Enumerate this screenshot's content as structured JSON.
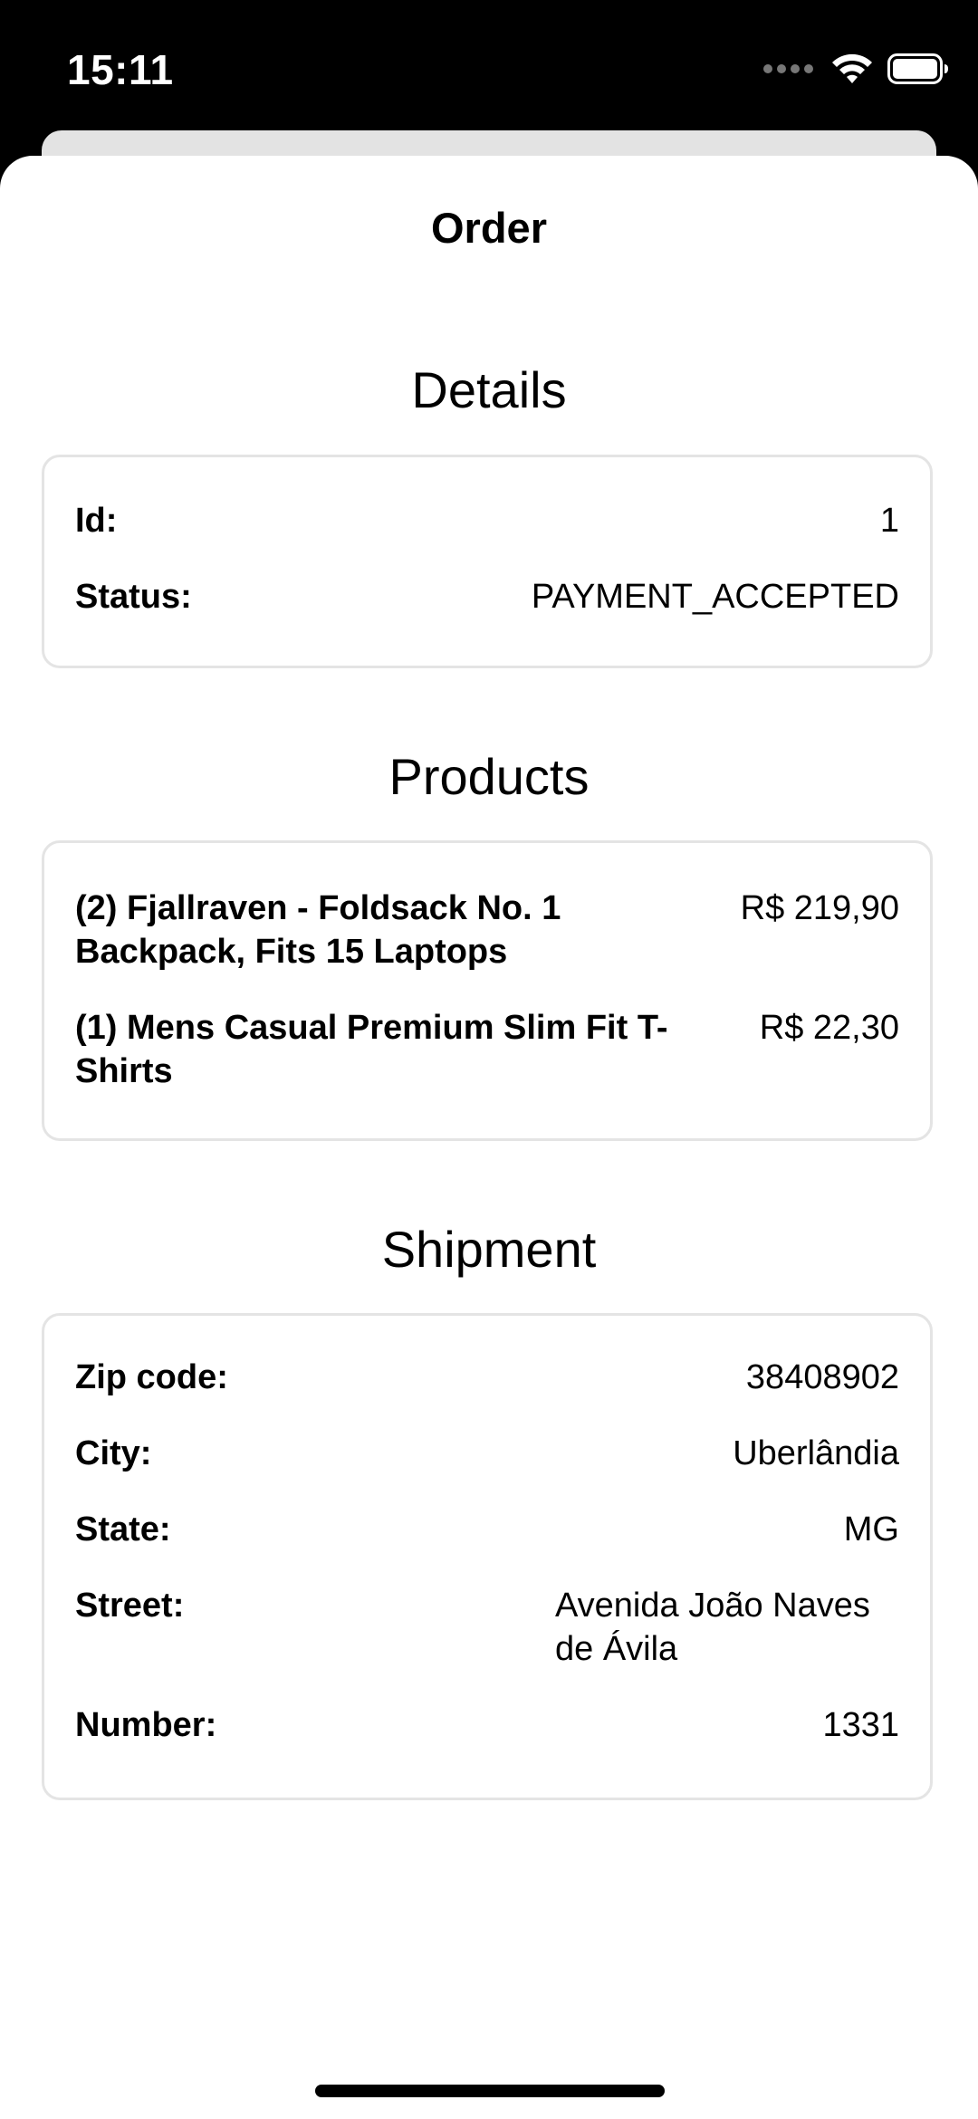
{
  "status_bar": {
    "time": "15:11",
    "icons": [
      "signal-icon",
      "wifi-icon",
      "battery-icon"
    ]
  },
  "nav": {
    "title": "Order"
  },
  "details": {
    "title": "Details",
    "id_label": "Id:",
    "id_value": "1",
    "status_label": "Status:",
    "status_value": "PAYMENT_ACCEPTED"
  },
  "products": {
    "title": "Products",
    "items": [
      {
        "name": "(2) Fjallraven - Foldsack No. 1 Backpack, Fits 15 Laptops",
        "price": "R$ 219,90"
      },
      {
        "name": "(1) Mens Casual Premium Slim Fit T-Shirts",
        "price": "R$ 22,30"
      }
    ]
  },
  "shipment": {
    "title": "Shipment",
    "zip_label": "Zip code:",
    "zip_value": "38408902",
    "city_label": "City:",
    "city_value": "Uberlândia",
    "state_label": "State:",
    "state_value": "MG",
    "street_label": "Street:",
    "street_value": "Avenida João Naves de Ávila",
    "number_label": "Number:",
    "number_value": "1331"
  },
  "colors": {
    "background": "#000000",
    "sheet": "#ffffff",
    "card_border": "#e4e4e4",
    "text": "#000000"
  }
}
